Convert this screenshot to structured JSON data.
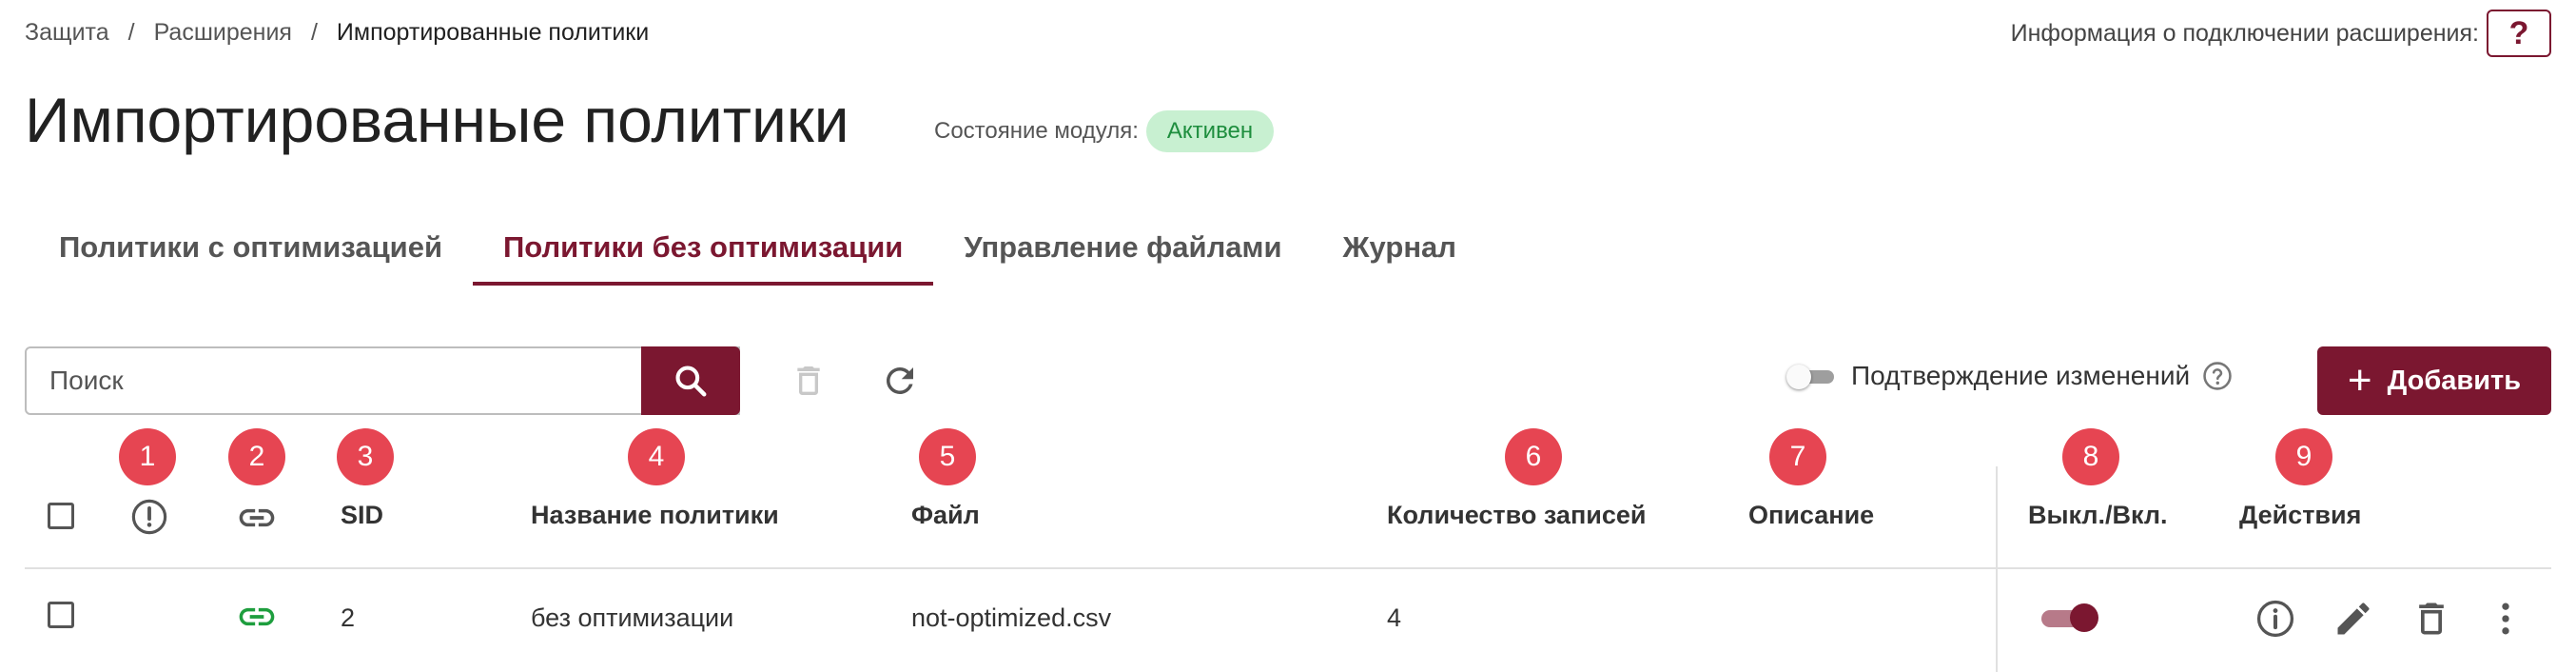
{
  "breadcrumb": {
    "items": [
      "Защита",
      "Расширения"
    ],
    "current": "Импортированные политики",
    "separator": "/"
  },
  "connection_info": {
    "label": "Информация о подключении расширения:",
    "button_label": "?"
  },
  "page": {
    "title": "Импортированные политики",
    "module_state_label": "Состояние модуля:",
    "module_state_value": "Активен"
  },
  "tabs": [
    {
      "label": "Политики с оптимизацией",
      "active": false
    },
    {
      "label": "Политики без оптимизации",
      "active": true
    },
    {
      "label": "Управление файлами",
      "active": false
    },
    {
      "label": "Журнал",
      "active": false
    }
  ],
  "toolbar": {
    "search_placeholder": "Поиск",
    "search_icon": "search-icon",
    "delete_icon": "trash-icon",
    "refresh_icon": "refresh-icon",
    "confirm_label": "Подтверждение изменений",
    "confirm_enabled": false,
    "add_label": "Добавить"
  },
  "markers": [
    "1",
    "2",
    "3",
    "4",
    "5",
    "6",
    "7",
    "8",
    "9"
  ],
  "table": {
    "columns": {
      "warning_icon": "alert-circle-icon",
      "link_icon": "link-icon",
      "sid": "SID",
      "name": "Название политики",
      "file": "Файл",
      "count": "Количество записей",
      "description": "Описание",
      "toggle": "Выкл./Вкл.",
      "actions": "Действия"
    },
    "rows": [
      {
        "sid": "2",
        "name": "без оптимизации",
        "file": "not-optimized.csv",
        "count": "4",
        "description": "",
        "enabled": true,
        "linked": true
      }
    ]
  },
  "colors": {
    "accent": "#7b1730",
    "marker": "#e64552",
    "badge_bg": "#c8f0d1",
    "badge_text": "#1e8e3e",
    "link_active": "#1e9e3e"
  }
}
